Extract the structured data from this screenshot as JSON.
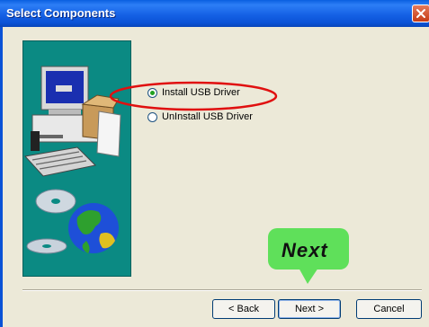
{
  "window": {
    "title": "Select Components"
  },
  "titlebar_icons": {
    "close": "close-icon"
  },
  "options": [
    {
      "label": "Install USB Driver",
      "checked": true
    },
    {
      "label": "UnInstall USB Driver",
      "checked": false
    }
  ],
  "buttons": {
    "back": "< Back",
    "next": "Next >",
    "cancel": "Cancel"
  },
  "callout": {
    "text": "Next",
    "color": "#5fe05a"
  },
  "highlight_color": "#e01010",
  "illustration": {
    "icons": [
      "computer-illustration",
      "cd-disc-illustration",
      "globe-illustration"
    ]
  }
}
